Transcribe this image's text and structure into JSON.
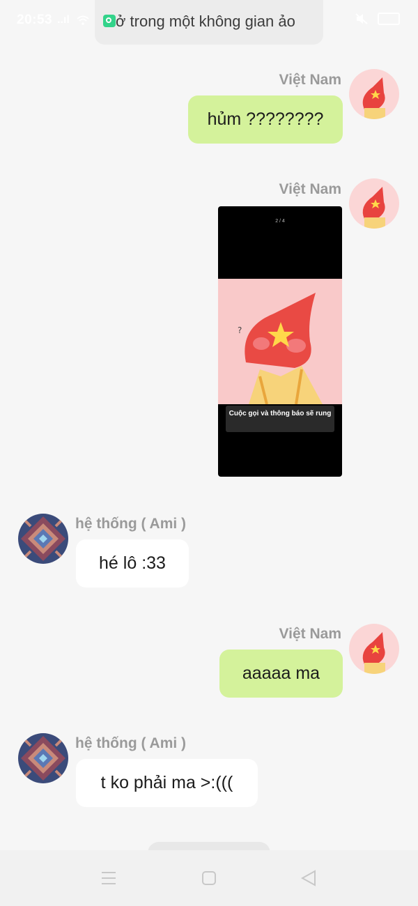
{
  "status_bar": {
    "time": "20:53",
    "signal": "..ıl",
    "wifi": "wifi-icon",
    "right": "mute-icon battery-icon"
  },
  "room": {
    "title": "ở trong một không gian ảo",
    "icon": "voice-room-icon"
  },
  "messages": [
    {
      "sender": "Việt Nam",
      "side": "right",
      "type": "text",
      "text": "hủm ????????"
    },
    {
      "sender": "Việt Nam",
      "side": "right",
      "type": "image",
      "image": {
        "page_indicator": "2 / 4",
        "toast": "Cuộc gọi và thông báo sẽ rung"
      }
    },
    {
      "sender": "hệ thống ( Ami )",
      "side": "left",
      "type": "text",
      "text": "hé lô :33"
    },
    {
      "sender": "Việt Nam",
      "side": "right",
      "type": "text",
      "text": "aaaaa ma"
    },
    {
      "sender": "hệ thống ( Ami )",
      "side": "left",
      "type": "text",
      "text": "t ko phải ma >:((("
    }
  ],
  "nav": {
    "menu": "menu-icon",
    "home": "home-icon",
    "back": "back-icon"
  },
  "colors": {
    "mine_bubble": "#d4f29b",
    "theirs_bubble": "#ffffff",
    "background": "#f6f6f6",
    "room_icon": "#33d38a"
  }
}
